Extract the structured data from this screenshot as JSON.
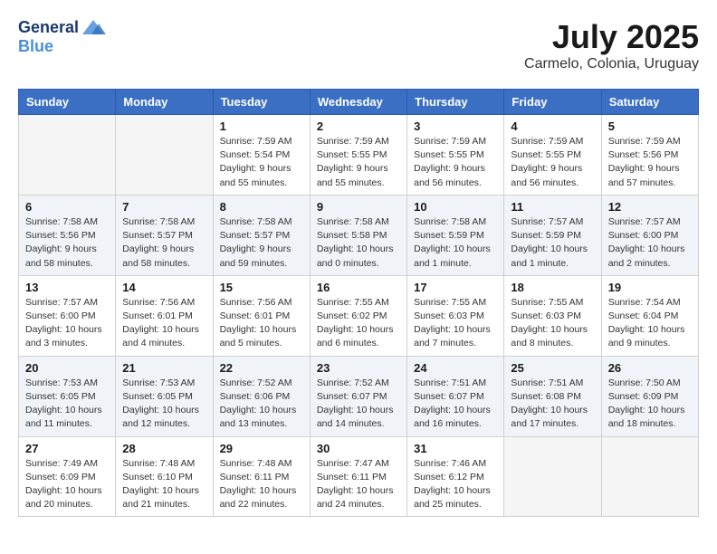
{
  "header": {
    "logo_line1": "General",
    "logo_line2": "Blue",
    "month_year": "July 2025",
    "location": "Carmelo, Colonia, Uruguay"
  },
  "weekdays": [
    "Sunday",
    "Monday",
    "Tuesday",
    "Wednesday",
    "Thursday",
    "Friday",
    "Saturday"
  ],
  "weeks": [
    [
      {
        "day": "",
        "info": ""
      },
      {
        "day": "",
        "info": ""
      },
      {
        "day": "1",
        "info": "Sunrise: 7:59 AM\nSunset: 5:54 PM\nDaylight: 9 hours\nand 55 minutes."
      },
      {
        "day": "2",
        "info": "Sunrise: 7:59 AM\nSunset: 5:55 PM\nDaylight: 9 hours\nand 55 minutes."
      },
      {
        "day": "3",
        "info": "Sunrise: 7:59 AM\nSunset: 5:55 PM\nDaylight: 9 hours\nand 56 minutes."
      },
      {
        "day": "4",
        "info": "Sunrise: 7:59 AM\nSunset: 5:55 PM\nDaylight: 9 hours\nand 56 minutes."
      },
      {
        "day": "5",
        "info": "Sunrise: 7:59 AM\nSunset: 5:56 PM\nDaylight: 9 hours\nand 57 minutes."
      }
    ],
    [
      {
        "day": "6",
        "info": "Sunrise: 7:58 AM\nSunset: 5:56 PM\nDaylight: 9 hours\nand 58 minutes."
      },
      {
        "day": "7",
        "info": "Sunrise: 7:58 AM\nSunset: 5:57 PM\nDaylight: 9 hours\nand 58 minutes."
      },
      {
        "day": "8",
        "info": "Sunrise: 7:58 AM\nSunset: 5:57 PM\nDaylight: 9 hours\nand 59 minutes."
      },
      {
        "day": "9",
        "info": "Sunrise: 7:58 AM\nSunset: 5:58 PM\nDaylight: 10 hours\nand 0 minutes."
      },
      {
        "day": "10",
        "info": "Sunrise: 7:58 AM\nSunset: 5:59 PM\nDaylight: 10 hours\nand 1 minute."
      },
      {
        "day": "11",
        "info": "Sunrise: 7:57 AM\nSunset: 5:59 PM\nDaylight: 10 hours\nand 1 minute."
      },
      {
        "day": "12",
        "info": "Sunrise: 7:57 AM\nSunset: 6:00 PM\nDaylight: 10 hours\nand 2 minutes."
      }
    ],
    [
      {
        "day": "13",
        "info": "Sunrise: 7:57 AM\nSunset: 6:00 PM\nDaylight: 10 hours\nand 3 minutes."
      },
      {
        "day": "14",
        "info": "Sunrise: 7:56 AM\nSunset: 6:01 PM\nDaylight: 10 hours\nand 4 minutes."
      },
      {
        "day": "15",
        "info": "Sunrise: 7:56 AM\nSunset: 6:01 PM\nDaylight: 10 hours\nand 5 minutes."
      },
      {
        "day": "16",
        "info": "Sunrise: 7:55 AM\nSunset: 6:02 PM\nDaylight: 10 hours\nand 6 minutes."
      },
      {
        "day": "17",
        "info": "Sunrise: 7:55 AM\nSunset: 6:03 PM\nDaylight: 10 hours\nand 7 minutes."
      },
      {
        "day": "18",
        "info": "Sunrise: 7:55 AM\nSunset: 6:03 PM\nDaylight: 10 hours\nand 8 minutes."
      },
      {
        "day": "19",
        "info": "Sunrise: 7:54 AM\nSunset: 6:04 PM\nDaylight: 10 hours\nand 9 minutes."
      }
    ],
    [
      {
        "day": "20",
        "info": "Sunrise: 7:53 AM\nSunset: 6:05 PM\nDaylight: 10 hours\nand 11 minutes."
      },
      {
        "day": "21",
        "info": "Sunrise: 7:53 AM\nSunset: 6:05 PM\nDaylight: 10 hours\nand 12 minutes."
      },
      {
        "day": "22",
        "info": "Sunrise: 7:52 AM\nSunset: 6:06 PM\nDaylight: 10 hours\nand 13 minutes."
      },
      {
        "day": "23",
        "info": "Sunrise: 7:52 AM\nSunset: 6:07 PM\nDaylight: 10 hours\nand 14 minutes."
      },
      {
        "day": "24",
        "info": "Sunrise: 7:51 AM\nSunset: 6:07 PM\nDaylight: 10 hours\nand 16 minutes."
      },
      {
        "day": "25",
        "info": "Sunrise: 7:51 AM\nSunset: 6:08 PM\nDaylight: 10 hours\nand 17 minutes."
      },
      {
        "day": "26",
        "info": "Sunrise: 7:50 AM\nSunset: 6:09 PM\nDaylight: 10 hours\nand 18 minutes."
      }
    ],
    [
      {
        "day": "27",
        "info": "Sunrise: 7:49 AM\nSunset: 6:09 PM\nDaylight: 10 hours\nand 20 minutes."
      },
      {
        "day": "28",
        "info": "Sunrise: 7:48 AM\nSunset: 6:10 PM\nDaylight: 10 hours\nand 21 minutes."
      },
      {
        "day": "29",
        "info": "Sunrise: 7:48 AM\nSunset: 6:11 PM\nDaylight: 10 hours\nand 22 minutes."
      },
      {
        "day": "30",
        "info": "Sunrise: 7:47 AM\nSunset: 6:11 PM\nDaylight: 10 hours\nand 24 minutes."
      },
      {
        "day": "31",
        "info": "Sunrise: 7:46 AM\nSunset: 6:12 PM\nDaylight: 10 hours\nand 25 minutes."
      },
      {
        "day": "",
        "info": ""
      },
      {
        "day": "",
        "info": ""
      }
    ]
  ]
}
